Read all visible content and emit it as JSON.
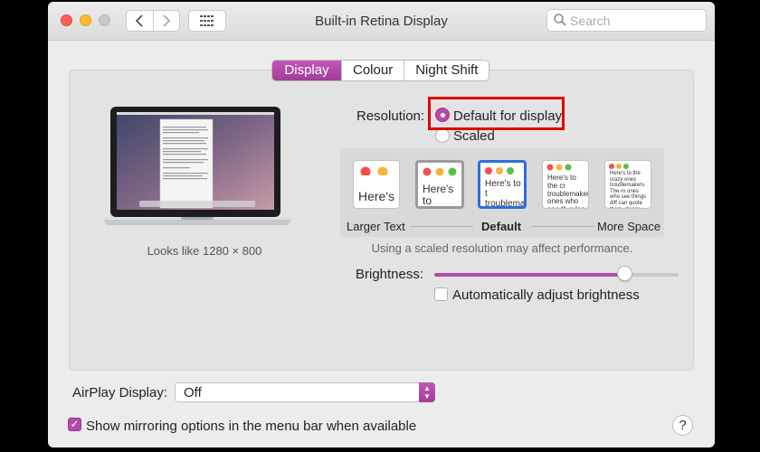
{
  "window": {
    "title": "Built-in Retina Display"
  },
  "toolbar": {
    "back_icon": "chevron-left-icon",
    "forward_icon": "chevron-right-icon",
    "grid_icon": "grid-icon",
    "search_placeholder": "Search"
  },
  "tabs": [
    {
      "label": "Display",
      "active": true
    },
    {
      "label": "Colour",
      "active": false
    },
    {
      "label": "Night Shift",
      "active": false
    }
  ],
  "display": {
    "looks_like": "Looks like 1280 × 800"
  },
  "resolution": {
    "label": "Resolution:",
    "options": [
      {
        "label": "Default for display",
        "selected": true
      },
      {
        "label": "Scaled",
        "selected": false
      }
    ]
  },
  "scaled": {
    "previews": [
      {
        "text": "Here's"
      },
      {
        "text": "Here's to troublem"
      },
      {
        "text": "Here's to t troublema ones who se"
      },
      {
        "text": "Here's to the cr troublemakers. ones who see th rules. And they"
      },
      {
        "text": "Here's to the crazy ones troublemakers. The ro ones who see things diff can quote them, disagr them. About the only thi Because they change th"
      }
    ],
    "left_label": "Larger Text",
    "center_label": "Default",
    "right_label": "More Space",
    "performance_note": "Using a scaled resolution may affect performance."
  },
  "brightness": {
    "label": "Brightness:",
    "level": 0.8,
    "auto_label": "Automatically adjust brightness",
    "auto_checked": false
  },
  "airplay": {
    "label": "AirPlay Display:",
    "value": "Off"
  },
  "mirroring": {
    "label": "Show mirroring options in the menu bar when available",
    "checked": true
  },
  "help": {
    "label": "?"
  },
  "colors": {
    "accent": "#b44aa9",
    "highlight": "#e00000"
  }
}
